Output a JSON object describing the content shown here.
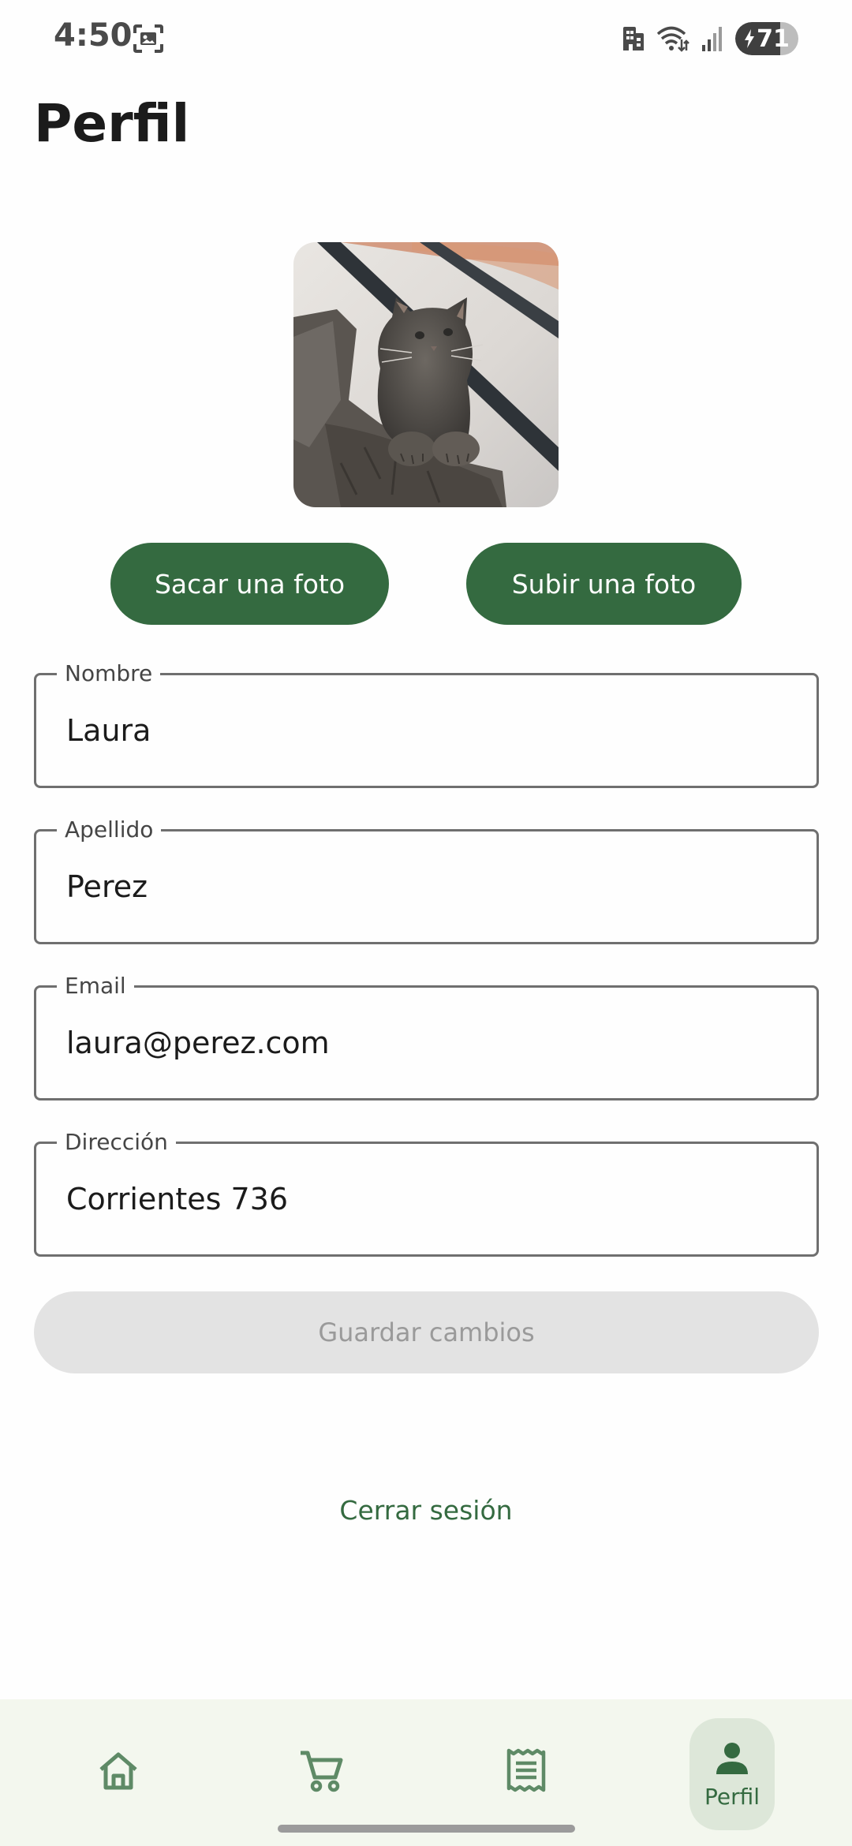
{
  "status_bar": {
    "time": "4:50",
    "battery_level": "71",
    "battery_fraction": 0.71,
    "icons": [
      "screenshot-icon",
      "work-profile-icon",
      "wifi-icon",
      "signal-icon",
      "battery-charging-icon"
    ]
  },
  "page": {
    "title": "Perfil"
  },
  "profile_photo": {
    "description_icon": "cat-photo"
  },
  "photo_buttons": {
    "take_photo": "Sacar una foto",
    "upload_photo": "Subir una foto"
  },
  "form": {
    "first_name": {
      "label": "Nombre",
      "value": "Laura"
    },
    "last_name": {
      "label": "Apellido",
      "value": "Perez"
    },
    "email": {
      "label": "Email",
      "value": "laura@perez.com"
    },
    "address": {
      "label": "Dirección",
      "value": "Corrientes 736"
    }
  },
  "save_button": {
    "label": "Guardar cambios",
    "enabled": false
  },
  "logout": {
    "label": "Cerrar sesión"
  },
  "bottom_nav": {
    "items": [
      {
        "icon": "home-icon",
        "active": false
      },
      {
        "icon": "cart-icon",
        "active": false
      },
      {
        "icon": "receipt-icon",
        "active": false
      },
      {
        "icon": "person-icon",
        "label": "Perfil",
        "active": true
      }
    ]
  },
  "colors": {
    "primary": "#346a40",
    "primary_container": "#dde7d9",
    "nav_background": "#f3f7ee",
    "disabled_background": "#e3e3e3",
    "disabled_text": "#9a9a9a",
    "outline": "#6f6f6f"
  }
}
